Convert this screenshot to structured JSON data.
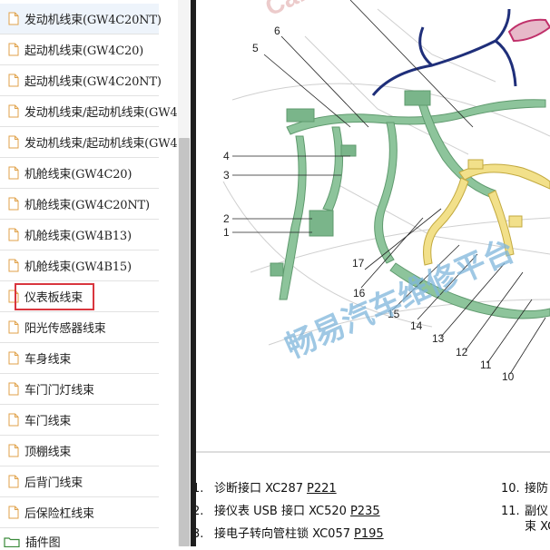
{
  "sidebar": {
    "items": [
      {
        "label": "发动机线束(GW4C20NT)"
      },
      {
        "label": "起动机线束(GW4C20)"
      },
      {
        "label": "起动机线束(GW4C20NT)"
      },
      {
        "label": "发动机线束/起动机线束(GW4"
      },
      {
        "label": "发动机线束/起动机线束(GW4"
      },
      {
        "label": "机舱线束(GW4C20)"
      },
      {
        "label": "机舱线束(GW4C20NT)"
      },
      {
        "label": "机舱线束(GW4B13)"
      },
      {
        "label": "机舱线束(GW4B15)"
      },
      {
        "label": "仪表板线束"
      },
      {
        "label": "阳光传感器线束"
      },
      {
        "label": "车身线束"
      },
      {
        "label": "车门门灯线束"
      },
      {
        "label": "车门线束"
      },
      {
        "label": "顶棚线束"
      },
      {
        "label": "后背门线束"
      },
      {
        "label": "后保险杠线束"
      }
    ],
    "tree_item": {
      "label": "插件图"
    }
  },
  "diagram": {
    "watermark": "畅易汽车维修平台",
    "watermark_top": "Car",
    "callouts": [
      "1",
      "2",
      "3",
      "4",
      "5",
      "6",
      "10",
      "11",
      "12",
      "13",
      "14",
      "15",
      "16",
      "17"
    ]
  },
  "legend": {
    "left": [
      {
        "num": "1.",
        "text": "诊断接口 XC287",
        "ref": "P221"
      },
      {
        "num": "2.",
        "text": "接仪表 USB 接口 XC520",
        "ref": "P235"
      },
      {
        "num": "3.",
        "text": "接电子转向管柱锁 XC057",
        "ref": "P195"
      }
    ],
    "right": [
      {
        "num": "10.",
        "text": "接防"
      },
      {
        "num": "11.",
        "text": "副仪"
      },
      {
        "num": "",
        "text": "束 XC"
      }
    ]
  },
  "colors": {
    "harness_green": "#8dc49b",
    "harness_yellow": "#f2e08a",
    "harness_blue": "#1f2f7a",
    "harness_pink": "#c0306a",
    "selection_border": "#d9363e",
    "watermark": "#7fb6dc"
  }
}
